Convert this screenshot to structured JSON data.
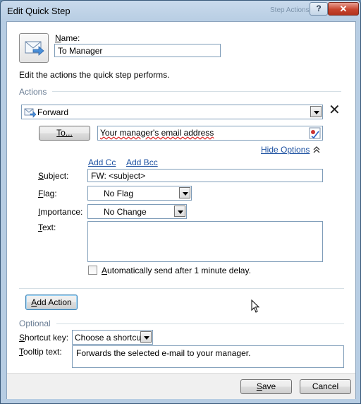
{
  "window": {
    "title": "Edit Quick Step",
    "ghost_title": "Step Actions",
    "help_label": "?",
    "close_label": "✕"
  },
  "name": {
    "label_u": "N",
    "label_rest": "ame:",
    "value": "To Manager"
  },
  "description": "Edit the actions the quick step performs.",
  "actions": {
    "group_label": "Actions",
    "action_select": "Forward",
    "remove_label": "✕",
    "to_button": "To...",
    "to_value": "Your manager's email address",
    "hide_options": "Hide Options",
    "add_cc": "Add Cc",
    "add_bcc": "Add Bcc",
    "subject_label_u": "S",
    "subject_label_rest": "ubject:",
    "subject_value": "FW: <subject>",
    "flag_label_u": "F",
    "flag_label_rest": "lag:",
    "flag_value": "No Flag",
    "importance_label_u": "I",
    "importance_label_rest": "mportance:",
    "importance_value": "No Change",
    "text_label_u": "T",
    "text_label_rest": "ext:",
    "text_value": "",
    "auto_send_u": "A",
    "auto_send_rest": "utomatically send after 1 minute delay.",
    "auto_send_checked": false,
    "add_action_u": "A",
    "add_action_rest": "dd Action"
  },
  "optional": {
    "group_label": "Optional",
    "shortcut_label_u": "S",
    "shortcut_label_rest": "hortcut key:",
    "shortcut_value": "Choose a shortcut",
    "tooltip_label_u": "T",
    "tooltip_label_rest": "ooltip text:",
    "tooltip_value": "Forwards the selected e-mail to your manager."
  },
  "footer": {
    "save_u": "S",
    "save_rest": "ave",
    "cancel_label": "Cancel"
  },
  "colors": {
    "link": "#1a4fa0",
    "title_bar": "#c9daec",
    "close_button": "#c7452e"
  }
}
